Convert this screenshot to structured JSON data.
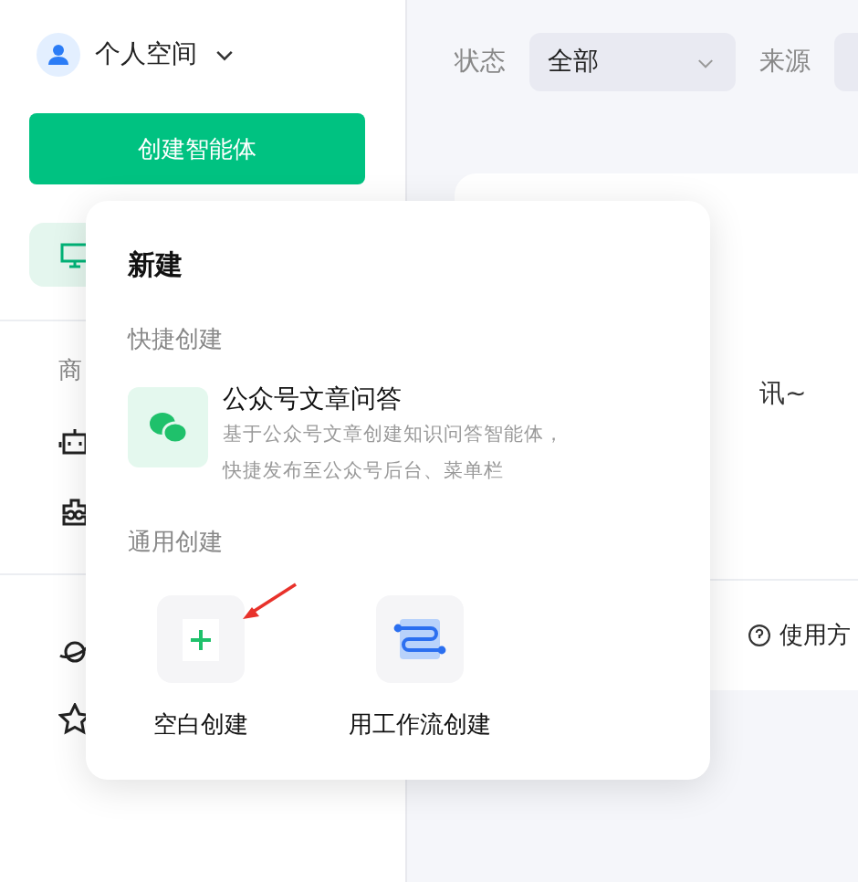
{
  "sidebar": {
    "space": {
      "label": "个人空间"
    },
    "create_button": "创建智能体",
    "nav_items": [
      {
        "selected": true
      }
    ],
    "section_label": "商",
    "tool_items": [
      {
        "selected": false
      },
      {
        "selected": false
      }
    ],
    "bottom_items": [
      {
        "selected": false
      },
      {
        "selected": false
      }
    ]
  },
  "filters": [
    {
      "label": "状态",
      "value": "全部"
    },
    {
      "label": "来源"
    }
  ],
  "card": {
    "text_1": "讯~",
    "action": "使用方"
  },
  "popup": {
    "title": "新建",
    "quick_section": "快捷创建",
    "quick_items": [
      {
        "title": "公众号文章问答",
        "description_lines": [
          "基于公众号文章创建知识问答智能体，",
          "快捷发布至公众号后台、菜单栏"
        ]
      }
    ],
    "general_section": "通用创建",
    "general_items": [
      {
        "kind": "blank",
        "label": "空白创建"
      },
      {
        "kind": "workflow",
        "label": "用工作流创建"
      }
    ]
  }
}
